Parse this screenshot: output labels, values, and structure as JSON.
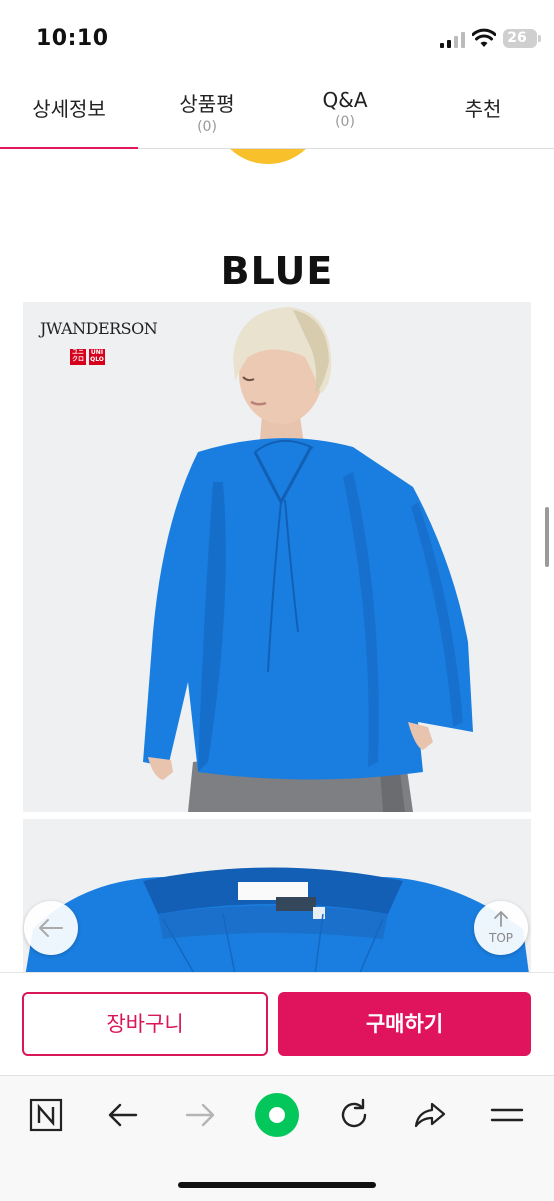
{
  "status_bar": {
    "time": "10:10",
    "battery": "26"
  },
  "tabs": [
    {
      "label": "상세정보",
      "count": ""
    },
    {
      "label": "상품평",
      "count": "(0)"
    },
    {
      "label": "Q&A",
      "count": "(0)"
    },
    {
      "label": "추천",
      "count": ""
    }
  ],
  "content": {
    "color_title": "BLUE",
    "image_brand": "JWANDERSON",
    "logo_text": [
      "ユニ クロ",
      "UNI QLO"
    ]
  },
  "float_buttons": {
    "top_label": "TOP"
  },
  "purchase_bar": {
    "cart_label": "장바구니",
    "buy_label": "구매하기"
  },
  "browser_toolbar": {
    "icons": [
      "n-logo-icon",
      "back-arrow-icon",
      "forward-arrow-icon",
      "green-dot-icon",
      "reload-icon",
      "share-icon",
      "menu-icon"
    ]
  },
  "colors": {
    "accent": "#e0145c",
    "shirt_blue": "#1a7ee0",
    "green": "#03c75a"
  }
}
